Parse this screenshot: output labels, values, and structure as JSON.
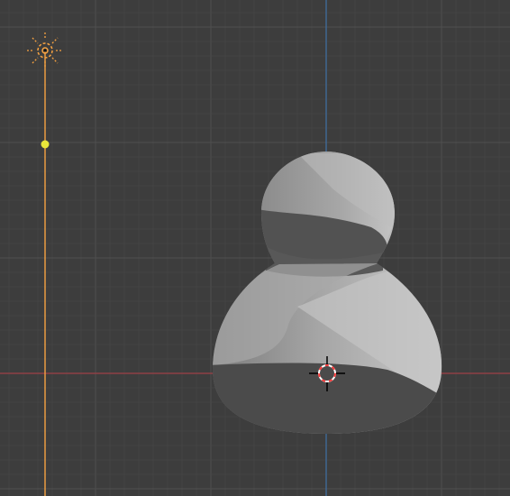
{
  "viewport": {
    "background_color": "#3d3d3d",
    "grid_minor_color": "#464646",
    "grid_major_color": "#4d4d4d",
    "x_axis_color": "#9c3f45",
    "z_axis_color": "#3d6fa5"
  },
  "objects": {
    "light": {
      "icon": "sun-lamp-icon",
      "color": "#f7a342",
      "selected": true
    },
    "light_direction_handle": {
      "icon": "yellow-dot-handle",
      "color": "#e9e63a"
    },
    "mesh": {
      "icon": "mesh-object",
      "shape": "pawn-like revolved mesh",
      "selected": false
    },
    "cursor_3d": {
      "icon": "3d-cursor-icon",
      "colors": [
        "#ff3b3b",
        "#ffffff",
        "#000000"
      ]
    }
  }
}
